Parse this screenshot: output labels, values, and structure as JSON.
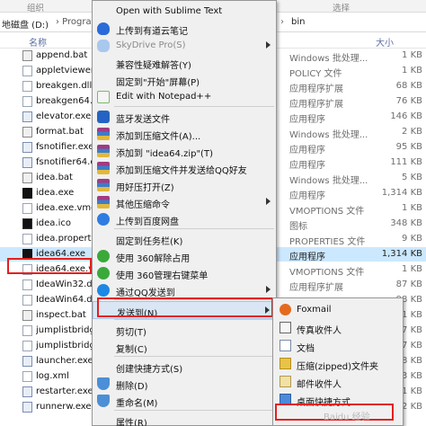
{
  "ribbon": {
    "left": "组织",
    "right": "选择"
  },
  "address": {
    "left": "地磁盘 (D:)",
    "sep": "› Progran",
    "right": "bin"
  },
  "columns": {
    "name": "名称",
    "size": "大小"
  },
  "files": [
    {
      "name": "append.bat",
      "icon": "bat-file-icon",
      "type": "Windows 批处理...",
      "size": "1 KB",
      "selected": false
    },
    {
      "name": "appletviewer.",
      "icon": "file-icon",
      "type": "POLICY 文件",
      "size": "1 KB",
      "selected": false
    },
    {
      "name": "breakgen.dll",
      "icon": "dll-file-icon",
      "type": "应用程序扩展",
      "size": "68 KB",
      "selected": false
    },
    {
      "name": "breakgen64.",
      "icon": "dll-file-icon",
      "type": "应用程序扩展",
      "size": "76 KB",
      "selected": false
    },
    {
      "name": "elevator.exe",
      "icon": "exe-file-icon",
      "type": "应用程序",
      "size": "146 KB",
      "selected": false
    },
    {
      "name": "format.bat",
      "icon": "bat-file-icon",
      "type": "Windows 批处理...",
      "size": "2 KB",
      "selected": false
    },
    {
      "name": "fsnotifier.exe",
      "icon": "exe-file-icon",
      "type": "应用程序",
      "size": "95 KB",
      "selected": false
    },
    {
      "name": "fsnotifier64.e",
      "icon": "exe-file-icon",
      "type": "应用程序",
      "size": "111 KB",
      "selected": false
    },
    {
      "name": "idea.bat",
      "icon": "bat-file-icon",
      "type": "Windows 批处理...",
      "size": "5 KB",
      "selected": false
    },
    {
      "name": "idea.exe",
      "icon": "idea-app-icon",
      "type": "应用程序",
      "size": "1,314 KB",
      "selected": false
    },
    {
      "name": "idea.exe.vmo",
      "icon": "file-icon",
      "type": "VMOPTIONS 文件",
      "size": "1 KB",
      "selected": false
    },
    {
      "name": "idea.ico",
      "icon": "ico-file-icon",
      "type": "图标",
      "size": "348 KB",
      "selected": false
    },
    {
      "name": "idea.propertie",
      "icon": "file-icon",
      "type": "PROPERTIES 文件",
      "size": "9 KB",
      "selected": false
    },
    {
      "name": "idea64.exe",
      "icon": "idea-app-icon",
      "type": "应用程序",
      "size": "1,314 KB",
      "selected": true
    },
    {
      "name": "idea64.exe.vr",
      "icon": "file-icon",
      "type": "VMOPTIONS 文件",
      "size": "1 KB",
      "selected": false
    },
    {
      "name": "IdeaWin32.dl",
      "icon": "dll-file-icon",
      "type": "应用程序扩展",
      "size": "87 KB",
      "selected": false
    },
    {
      "name": "IdeaWin64.dl",
      "icon": "dll-file-icon",
      "type": "应用程序扩展",
      "size": "98 KB",
      "selected": false
    },
    {
      "name": "inspect.bat",
      "icon": "bat-file-icon",
      "type": "Windows 批处理...",
      "size": "1 KB",
      "selected": false
    },
    {
      "name": "jumplistbridg",
      "icon": "dll-file-icon",
      "type": "应用程序扩展",
      "size": "67 KB",
      "selected": false
    },
    {
      "name": "jumplistbridg",
      "icon": "dll-file-icon",
      "type": "应用程序扩展",
      "size": "77 KB",
      "selected": false
    },
    {
      "name": "launcher.exe",
      "icon": "exe-file-icon",
      "type": "应用程序",
      "size": "118 KB",
      "selected": false
    },
    {
      "name": "log.xml",
      "icon": "xml-file-icon",
      "type": "XML 文档",
      "size": "3 KB",
      "selected": false
    },
    {
      "name": "restarter.exe",
      "icon": "exe-file-icon",
      "type": "应用程序",
      "size": "91 KB",
      "selected": false
    },
    {
      "name": "runnerw.exe",
      "icon": "exe-file-icon",
      "type": "应用程序",
      "size": "132 KB",
      "selected": false
    }
  ],
  "menu": [
    {
      "label": "Open with Sublime Text",
      "icon": "",
      "arrow": false,
      "disabled": false,
      "highlight": false
    },
    {
      "label": "上传到有道云笔记",
      "icon": "cloud-icon",
      "arrow": false,
      "disabled": false,
      "highlight": false
    },
    {
      "label": "SkyDrive Pro(S)",
      "icon": "skydrive-icon",
      "arrow": true,
      "disabled": true,
      "highlight": false
    },
    {
      "label": "兼容性疑难解答(Y)",
      "icon": "",
      "arrow": false,
      "disabled": false,
      "highlight": false
    },
    {
      "label": "固定到\"开始\"屏幕(P)",
      "icon": "",
      "arrow": false,
      "disabled": false,
      "highlight": false
    },
    {
      "label": "Edit with Notepad++",
      "icon": "notepadpp-icon",
      "arrow": false,
      "disabled": false,
      "highlight": false
    },
    {
      "label": "蓝牙发送文件",
      "icon": "bluetooth-icon",
      "arrow": false,
      "disabled": false,
      "highlight": false
    },
    {
      "label": "添加到压缩文件(A)...",
      "icon": "winrar-icon",
      "arrow": false,
      "disabled": false,
      "highlight": false
    },
    {
      "label": "添加到 \"idea64.zip\"(T)",
      "icon": "winrar-icon",
      "arrow": false,
      "disabled": false,
      "highlight": false
    },
    {
      "label": "添加到压缩文件并发送给QQ好友",
      "icon": "winrar-icon",
      "arrow": false,
      "disabled": false,
      "highlight": false
    },
    {
      "label": "用好压打开(Z)",
      "icon": "winrar-icon",
      "arrow": false,
      "disabled": false,
      "highlight": false
    },
    {
      "label": "其他压缩命令",
      "icon": "winrar-icon",
      "arrow": true,
      "disabled": false,
      "highlight": false
    },
    {
      "label": "上传到百度网盘",
      "icon": "baidu-cloud-icon",
      "arrow": false,
      "disabled": false,
      "highlight": false
    },
    {
      "label": "固定到任务栏(K)",
      "icon": "",
      "arrow": false,
      "disabled": false,
      "highlight": false
    },
    {
      "label": "使用 360解除占用",
      "icon": "360-icon",
      "arrow": false,
      "disabled": false,
      "highlight": false
    },
    {
      "label": "使用 360管理右键菜单",
      "icon": "360-icon",
      "arrow": false,
      "disabled": false,
      "highlight": false
    },
    {
      "label": "通过QQ发送到",
      "icon": "qq-icon",
      "arrow": true,
      "disabled": false,
      "highlight": false
    },
    {
      "label": "发送到(N)",
      "icon": "",
      "arrow": true,
      "disabled": false,
      "highlight": true
    },
    {
      "label": "剪切(T)",
      "icon": "",
      "arrow": false,
      "disabled": false,
      "highlight": false
    },
    {
      "label": "复制(C)",
      "icon": "",
      "arrow": false,
      "disabled": false,
      "highlight": false
    },
    {
      "label": "创建快捷方式(S)",
      "icon": "",
      "arrow": false,
      "disabled": false,
      "highlight": false
    },
    {
      "label": "删除(D)",
      "icon": "shield-icon",
      "arrow": false,
      "disabled": false,
      "highlight": false
    },
    {
      "label": "重命名(M)",
      "icon": "shield-icon",
      "arrow": false,
      "disabled": false,
      "highlight": false
    },
    {
      "label": "属性(R)",
      "icon": "",
      "arrow": false,
      "disabled": false,
      "highlight": false
    }
  ],
  "submenu": [
    {
      "label": "Foxmail",
      "icon": "foxmail-icon"
    },
    {
      "label": "传真收件人",
      "icon": "fax-icon"
    },
    {
      "label": "文档",
      "icon": "documents-icon"
    },
    {
      "label": "压缩(zipped)文件夹",
      "icon": "zip-folder-icon"
    },
    {
      "label": "邮件收件人",
      "icon": "mail-icon"
    },
    {
      "label": "桌面快捷方式",
      "icon": "desktop-icon"
    }
  ],
  "watermark": "Baidu 经验"
}
